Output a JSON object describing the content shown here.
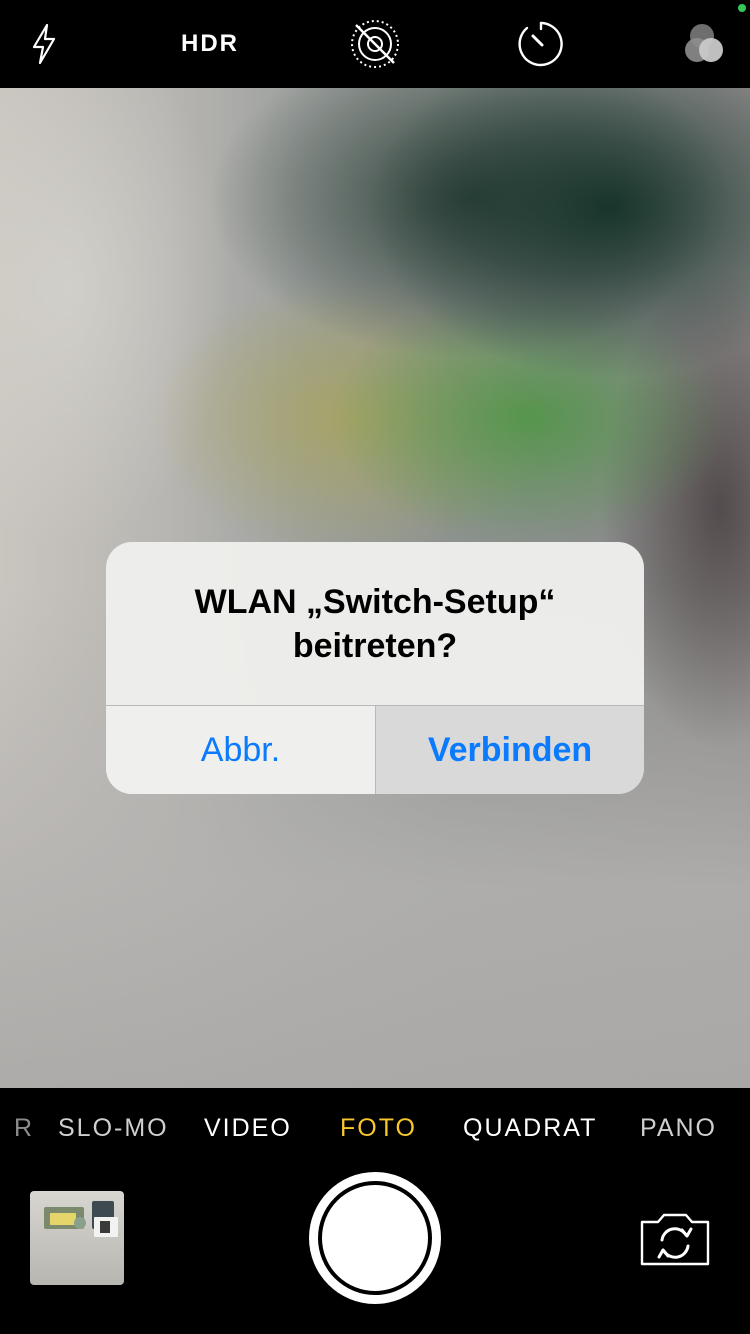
{
  "top_bar": {
    "flash_icon": "flash-icon",
    "hdr_label": "HDR",
    "live_photo_icon": "live-photo-off-icon",
    "timer_icon": "timer-icon",
    "filters_icon": "filters-icon",
    "indicator_color": "#34c759"
  },
  "alert": {
    "title_line1": "WLAN „Switch-Setup“",
    "title_line2": "beitreten?",
    "cancel_label": "Abbr.",
    "connect_label": "Verbinden",
    "button_color": "#0a7aff"
  },
  "modes": {
    "partial_left": "R",
    "items": [
      "SLO-MO",
      "VIDEO",
      "FOTO",
      "QUADRAT",
      "PANO"
    ],
    "selected": "FOTO",
    "selected_color": "#f7c72c"
  },
  "bottom_controls": {
    "thumbnail_icon": "last-photo-thumbnail",
    "shutter_icon": "shutter-button",
    "flip_icon": "flip-camera-icon"
  }
}
